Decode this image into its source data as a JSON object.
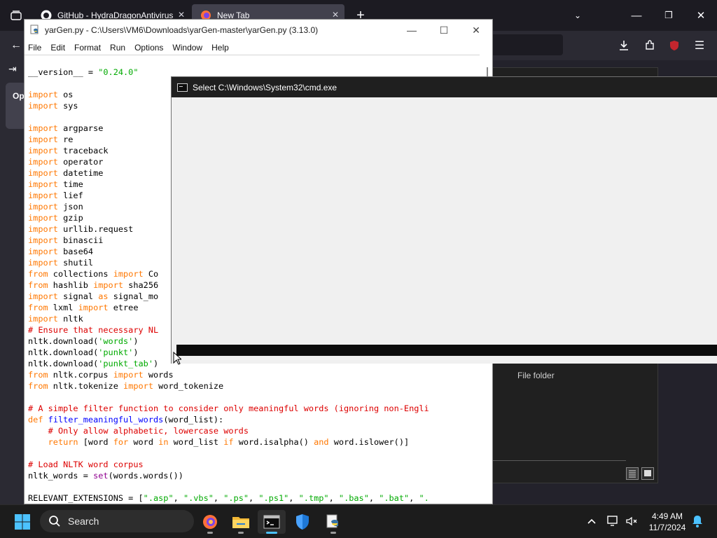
{
  "firefox": {
    "tabs": [
      {
        "title": "GitHub - HydraDragonAntivirus"
      },
      {
        "title": "New Tab"
      }
    ],
    "sidebar_card_label": "Op",
    "explorer_folder_type": "File folder"
  },
  "idle": {
    "title": "yarGen.py - C:\\Users\\VM6\\Downloads\\yarGen-master\\yarGen.py (3.13.0)",
    "menu": [
      "File",
      "Edit",
      "Format",
      "Run",
      "Options",
      "Window",
      "Help"
    ],
    "code_lines": [
      [
        [
          "",
          "__version__ = "
        ],
        [
          "st",
          "\"0.24.0\""
        ]
      ],
      [],
      [
        [
          "kw",
          "import"
        ],
        [
          "",
          " os"
        ]
      ],
      [
        [
          "kw",
          "import"
        ],
        [
          "",
          " sys"
        ]
      ],
      [],
      [
        [
          "kw",
          "import"
        ],
        [
          "",
          " argparse"
        ]
      ],
      [
        [
          "kw",
          "import"
        ],
        [
          "",
          " re"
        ]
      ],
      [
        [
          "kw",
          "import"
        ],
        [
          "",
          " traceback"
        ]
      ],
      [
        [
          "kw",
          "import"
        ],
        [
          "",
          " operator"
        ]
      ],
      [
        [
          "kw",
          "import"
        ],
        [
          "",
          " datetime"
        ]
      ],
      [
        [
          "kw",
          "import"
        ],
        [
          "",
          " time"
        ]
      ],
      [
        [
          "kw",
          "import"
        ],
        [
          "",
          " lief"
        ]
      ],
      [
        [
          "kw",
          "import"
        ],
        [
          "",
          " json"
        ]
      ],
      [
        [
          "kw",
          "import"
        ],
        [
          "",
          " gzip"
        ]
      ],
      [
        [
          "kw",
          "import"
        ],
        [
          "",
          " urllib.request"
        ]
      ],
      [
        [
          "kw",
          "import"
        ],
        [
          "",
          " binascii"
        ]
      ],
      [
        [
          "kw",
          "import"
        ],
        [
          "",
          " base64"
        ]
      ],
      [
        [
          "kw",
          "import"
        ],
        [
          "",
          " shutil"
        ]
      ],
      [
        [
          "kw",
          "from"
        ],
        [
          "",
          " collections "
        ],
        [
          "kw",
          "import"
        ],
        [
          "",
          " Co"
        ]
      ],
      [
        [
          "kw",
          "from"
        ],
        [
          "",
          " hashlib "
        ],
        [
          "kw",
          "import"
        ],
        [
          "",
          " sha256"
        ]
      ],
      [
        [
          "kw",
          "import"
        ],
        [
          "",
          " signal "
        ],
        [
          "kw",
          "as"
        ],
        [
          "",
          " signal_mo"
        ]
      ],
      [
        [
          "kw",
          "from"
        ],
        [
          "",
          " lxml "
        ],
        [
          "kw",
          "import"
        ],
        [
          "",
          " etree"
        ]
      ],
      [
        [
          "kw",
          "import"
        ],
        [
          "",
          " nltk"
        ]
      ],
      [
        [
          "cm",
          "# Ensure that necessary NL"
        ]
      ],
      [
        [
          "",
          "nltk.download("
        ],
        [
          "st",
          "'words'"
        ],
        [
          "",
          ")"
        ]
      ],
      [
        [
          "",
          "nltk.download("
        ],
        [
          "st",
          "'punkt'"
        ],
        [
          "",
          ")"
        ]
      ],
      [
        [
          "",
          "nltk.download("
        ],
        [
          "st",
          "'punkt_tab'"
        ],
        [
          "",
          ")"
        ]
      ],
      [
        [
          "kw",
          "from"
        ],
        [
          "",
          " nltk.corpus "
        ],
        [
          "kw",
          "import"
        ],
        [
          "",
          " words"
        ]
      ],
      [
        [
          "kw",
          "from"
        ],
        [
          "",
          " nltk.tokenize "
        ],
        [
          "kw",
          "import"
        ],
        [
          "",
          " word_tokenize"
        ]
      ],
      [],
      [
        [
          "cm",
          "# A simple filter function to consider only meaningful words (ignoring non-Engli"
        ]
      ],
      [
        [
          "kw",
          "def"
        ],
        [
          "",
          " "
        ],
        [
          "df",
          "filter_meaningful_words"
        ],
        [
          "",
          "(word_list):"
        ]
      ],
      [
        [
          "cm",
          "    # Only allow alphabetic, lowercase words"
        ]
      ],
      [
        [
          "",
          "    "
        ],
        [
          "kw",
          "return"
        ],
        [
          "",
          " [word "
        ],
        [
          "kw",
          "for"
        ],
        [
          "",
          " word "
        ],
        [
          "kw",
          "in"
        ],
        [
          "",
          " word_list "
        ],
        [
          "kw",
          "if"
        ],
        [
          "",
          " word.isalpha() "
        ],
        [
          "kw",
          "and"
        ],
        [
          "",
          " word.islower()]"
        ]
      ],
      [],
      [
        [
          "cm",
          "# Load NLTK word corpus"
        ]
      ],
      [
        [
          "",
          "nltk_words = "
        ],
        [
          "bi",
          "set"
        ],
        [
          "",
          "(words.words())"
        ]
      ],
      [],
      [
        [
          "",
          "RELEVANT_EXTENSIONS = ["
        ],
        [
          "st",
          "\".asp\""
        ],
        [
          "",
          ", "
        ],
        [
          "st",
          "\".vbs\""
        ],
        [
          "",
          ", "
        ],
        [
          "st",
          "\".ps\""
        ],
        [
          "",
          ", "
        ],
        [
          "st",
          "\".ps1\""
        ],
        [
          "",
          ", "
        ],
        [
          "st",
          "\".tmp\""
        ],
        [
          "",
          ", "
        ],
        [
          "st",
          "\".bas\""
        ],
        [
          "",
          ", "
        ],
        [
          "st",
          "\".bat\""
        ],
        [
          "",
          ", "
        ],
        [
          "st",
          "\"."
        ]
      ]
    ]
  },
  "cmd": {
    "title": "Select C:\\Windows\\System32\\cmd.exe"
  },
  "taskbar": {
    "search_label": "Search",
    "time": "4:49 AM",
    "date": "11/7/2024"
  },
  "colors": {
    "keyword": "#ff7700",
    "string": "#00aa00",
    "comment": "#dd0000",
    "definition": "#0000ff",
    "builtin": "#900090",
    "accent": "#4cc2ff"
  }
}
